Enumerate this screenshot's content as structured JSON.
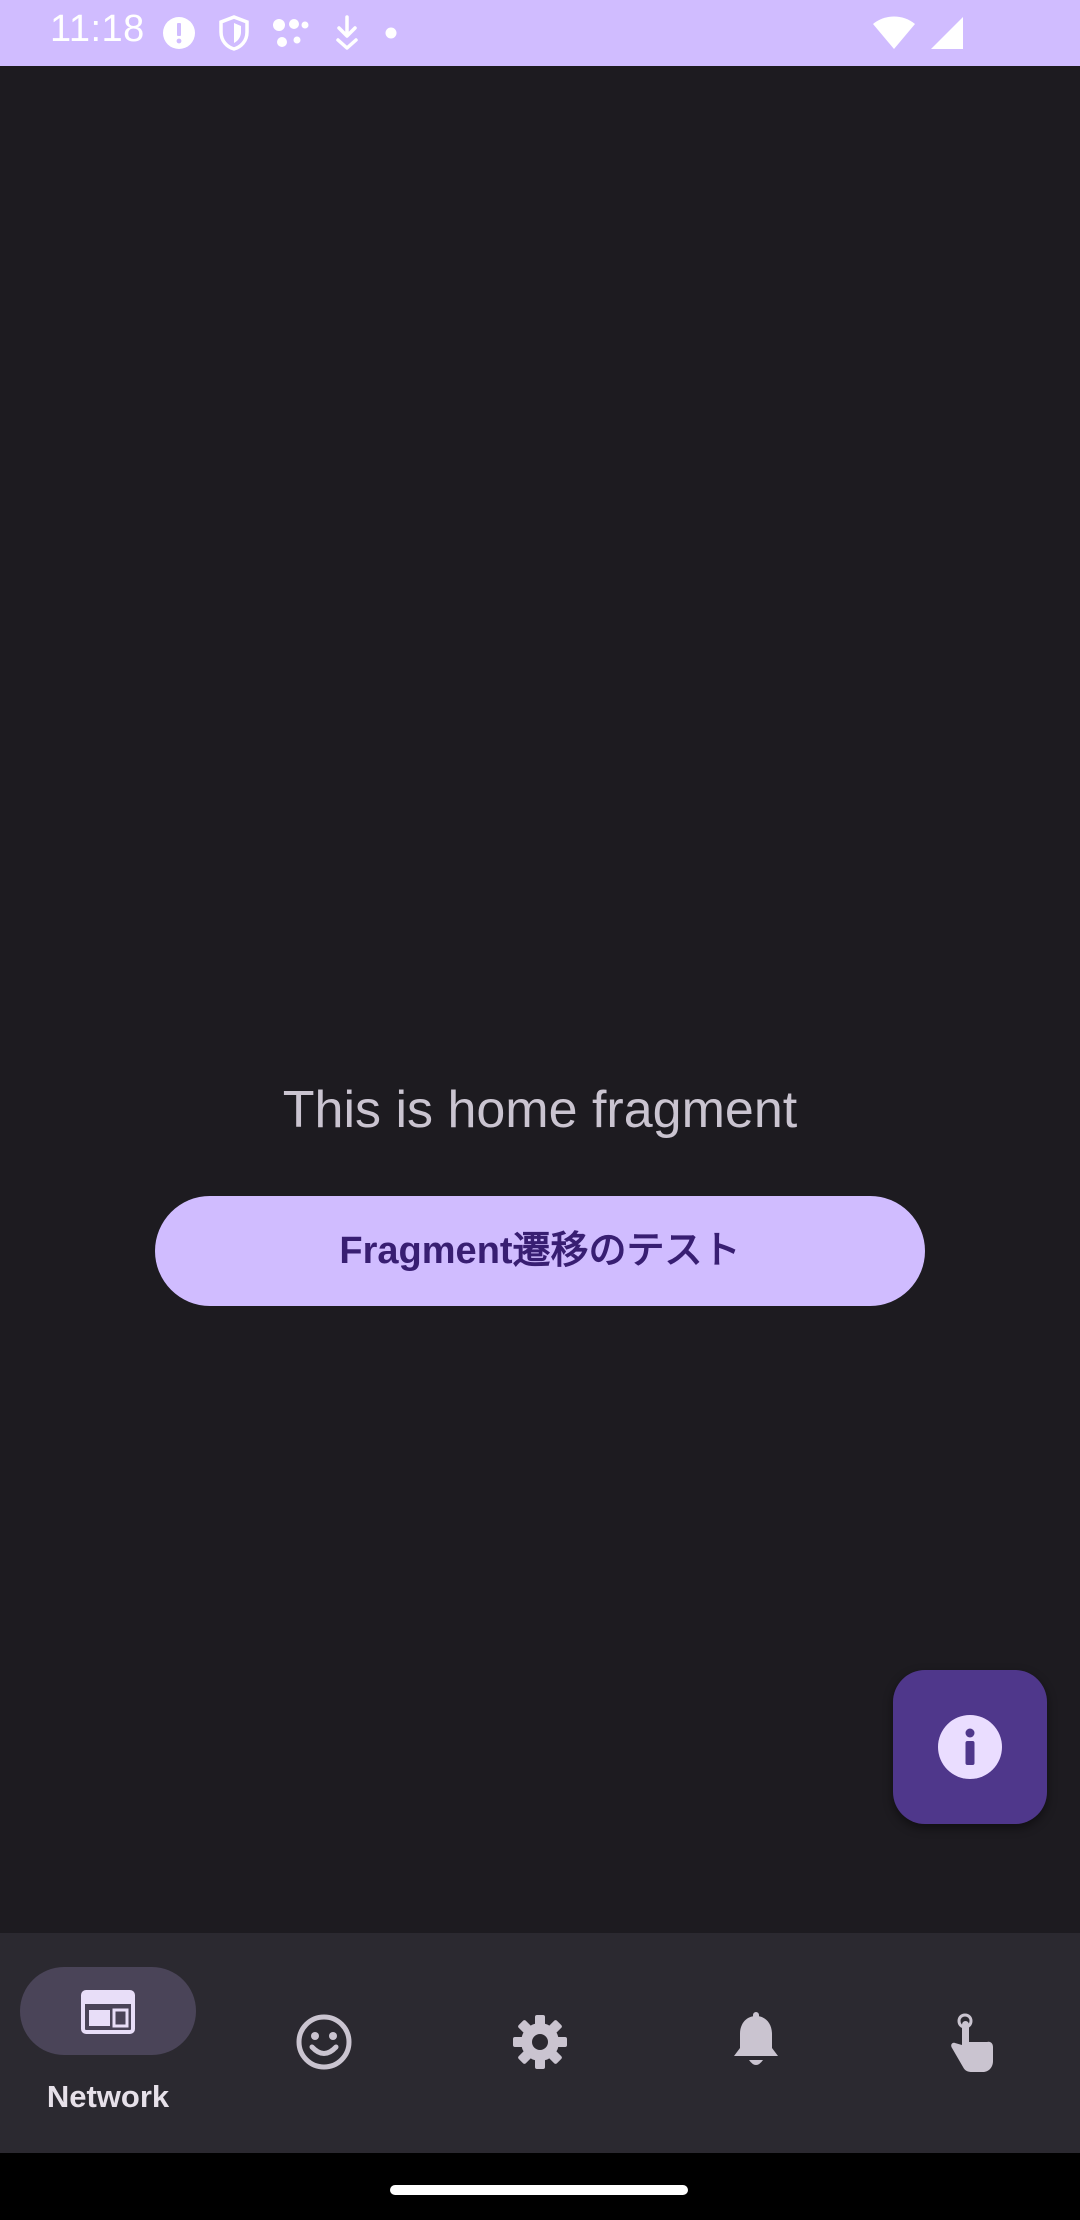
{
  "status_bar": {
    "time": "11:18",
    "left_icons": [
      "alert-circle-icon",
      "shield-icon",
      "connected-dots-icon",
      "download-arrow-icon",
      "small-dot-icon"
    ],
    "right_icons": [
      "wifi-icon",
      "cell-signal-icon"
    ]
  },
  "content": {
    "message": "This is home fragment",
    "button_label": "Fragment遷移のテスト"
  },
  "fab": {
    "icon": "info-icon"
  },
  "bottom_nav": {
    "items": [
      {
        "label": "Network",
        "icon": "web-panel-icon",
        "selected": true
      },
      {
        "label": "",
        "icon": "smiley-face-icon",
        "selected": false
      },
      {
        "label": "",
        "icon": "gear-icon",
        "selected": false
      },
      {
        "label": "",
        "icon": "bell-icon",
        "selected": false
      },
      {
        "label": "",
        "icon": "touch-hand-icon",
        "selected": false
      }
    ]
  },
  "colors": {
    "status_bar_bg": "#d0bcff",
    "content_bg": "#1d1b20",
    "text_secondary": "#cac4d0",
    "button_bg": "#d0bcff",
    "button_text": "#381e72",
    "fab_bg": "#4f378b",
    "nav_bg": "#2b2930",
    "nav_indicator": "#4a4458",
    "gesture_bar_bg": "#000000"
  }
}
